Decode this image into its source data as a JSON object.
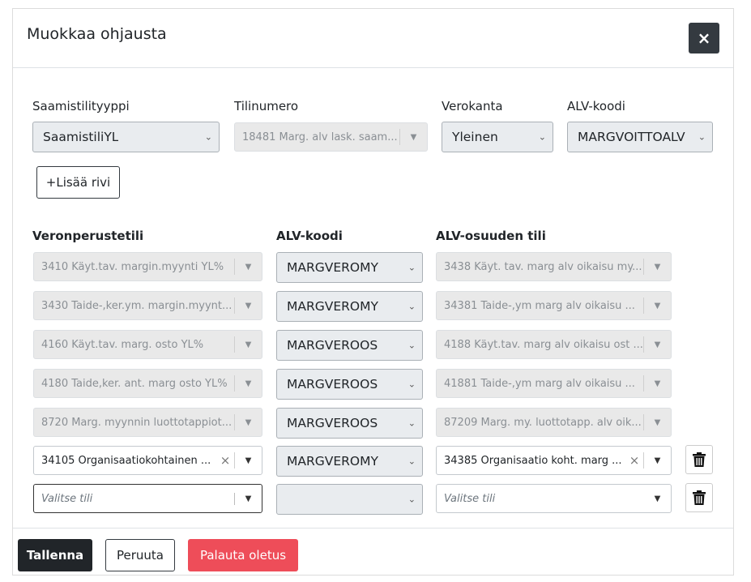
{
  "modal": {
    "title": "Muokkaa ohjausta",
    "close_icon": "×"
  },
  "top": {
    "labels": {
      "type": "Saamistilityyppi",
      "account": "Tilinumero",
      "vat_rate": "Verokanta",
      "vat_code": "ALV-koodi"
    },
    "type_value": "SaamistiliYL",
    "account_value": "18481 Marg. alv lask. saam...",
    "vat_rate_value": "Yleinen",
    "vat_code_value": "MARGVOITTOALV",
    "add_row_label": "+Lisää rivi"
  },
  "table": {
    "headers": {
      "base": "Veronperustetili",
      "code": "ALV-koodi",
      "vat": "ALV-osuuden tili"
    },
    "rows": [
      {
        "base": "3410 Käyt.tav. margin.myynti YL%",
        "code": "MARGVEROMY",
        "vat": "3438 Käyt. tav. marg alv oikaisu my..."
      },
      {
        "base": "3430 Taide-,ker.ym. margin.myynt...",
        "code": "MARGVEROMY",
        "vat": "34381 Taide-,ym marg alv oikaisu ..."
      },
      {
        "base": "4160 Käyt.tav. marg. osto YL%",
        "code": "MARGVEROOS",
        "vat": "4188 Käyt.tav. marg alv oikaisu ost ..."
      },
      {
        "base": "4180 Taide,ker. ant. marg osto YL%",
        "code": "MARGVEROOS",
        "vat": "41881 Taide-,ym marg alv oikaisu ..."
      },
      {
        "base": "8720 Marg. myynnin luottotappiot...",
        "code": "MARGVEROOS",
        "vat": "87209 Marg. my. luottotapp. alv oik..."
      },
      {
        "base": "34105 Organisaatiokohtainen ...",
        "code": "MARGVEROMY",
        "vat": "34385 Organisaatio koht. marg ..."
      }
    ],
    "new_row": {
      "base_placeholder": "Valitse tili",
      "code": "",
      "vat_placeholder": "Valitse tili"
    }
  },
  "footer": {
    "save": "Tallenna",
    "cancel": "Peruuta",
    "reset": "Palauta oletus"
  },
  "icons": {
    "chevron": "chevron-down-icon",
    "caret": "caret-down-icon",
    "clear": "clear-x-icon",
    "trash": "trash-icon",
    "close": "close-icon"
  },
  "colors": {
    "dark": "#212529",
    "danger": "#ee4d59",
    "disabled": "#e9ecef"
  }
}
